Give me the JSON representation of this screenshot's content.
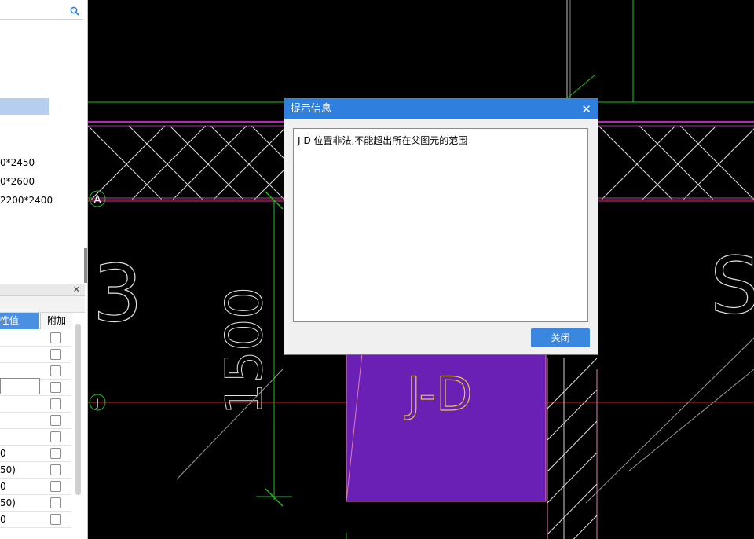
{
  "tree": {
    "items": [
      {
        "label": "0*2450"
      },
      {
        "label": "0*2600"
      },
      {
        "label": "2200*2400"
      }
    ]
  },
  "properties": {
    "header_value": "性值",
    "header_additional": "附加",
    "rows": [
      {
        "value": ""
      },
      {
        "value": ""
      },
      {
        "value": ""
      },
      {
        "value": ""
      },
      {
        "value": ""
      },
      {
        "value": ""
      },
      {
        "value": ""
      },
      {
        "value": "0"
      },
      {
        "value": "50)"
      },
      {
        "value": "0"
      },
      {
        "value": "50)"
      },
      {
        "value": "0"
      }
    ]
  },
  "cad": {
    "axis_labels": [
      "A",
      "J"
    ],
    "dimension": "1500",
    "element_label": "J-D",
    "left_text": "3",
    "right_text": "S"
  },
  "dialog": {
    "title": "提示信息",
    "message": "J-D 位置非法,不能超出所在父图元的范围",
    "close_button": "关闭"
  },
  "colors": {
    "dialog_title_bg": "#2e7fde",
    "button_bg": "#3a87e0",
    "cad_background": "#000000",
    "element_fill": "#6a1fb5"
  }
}
